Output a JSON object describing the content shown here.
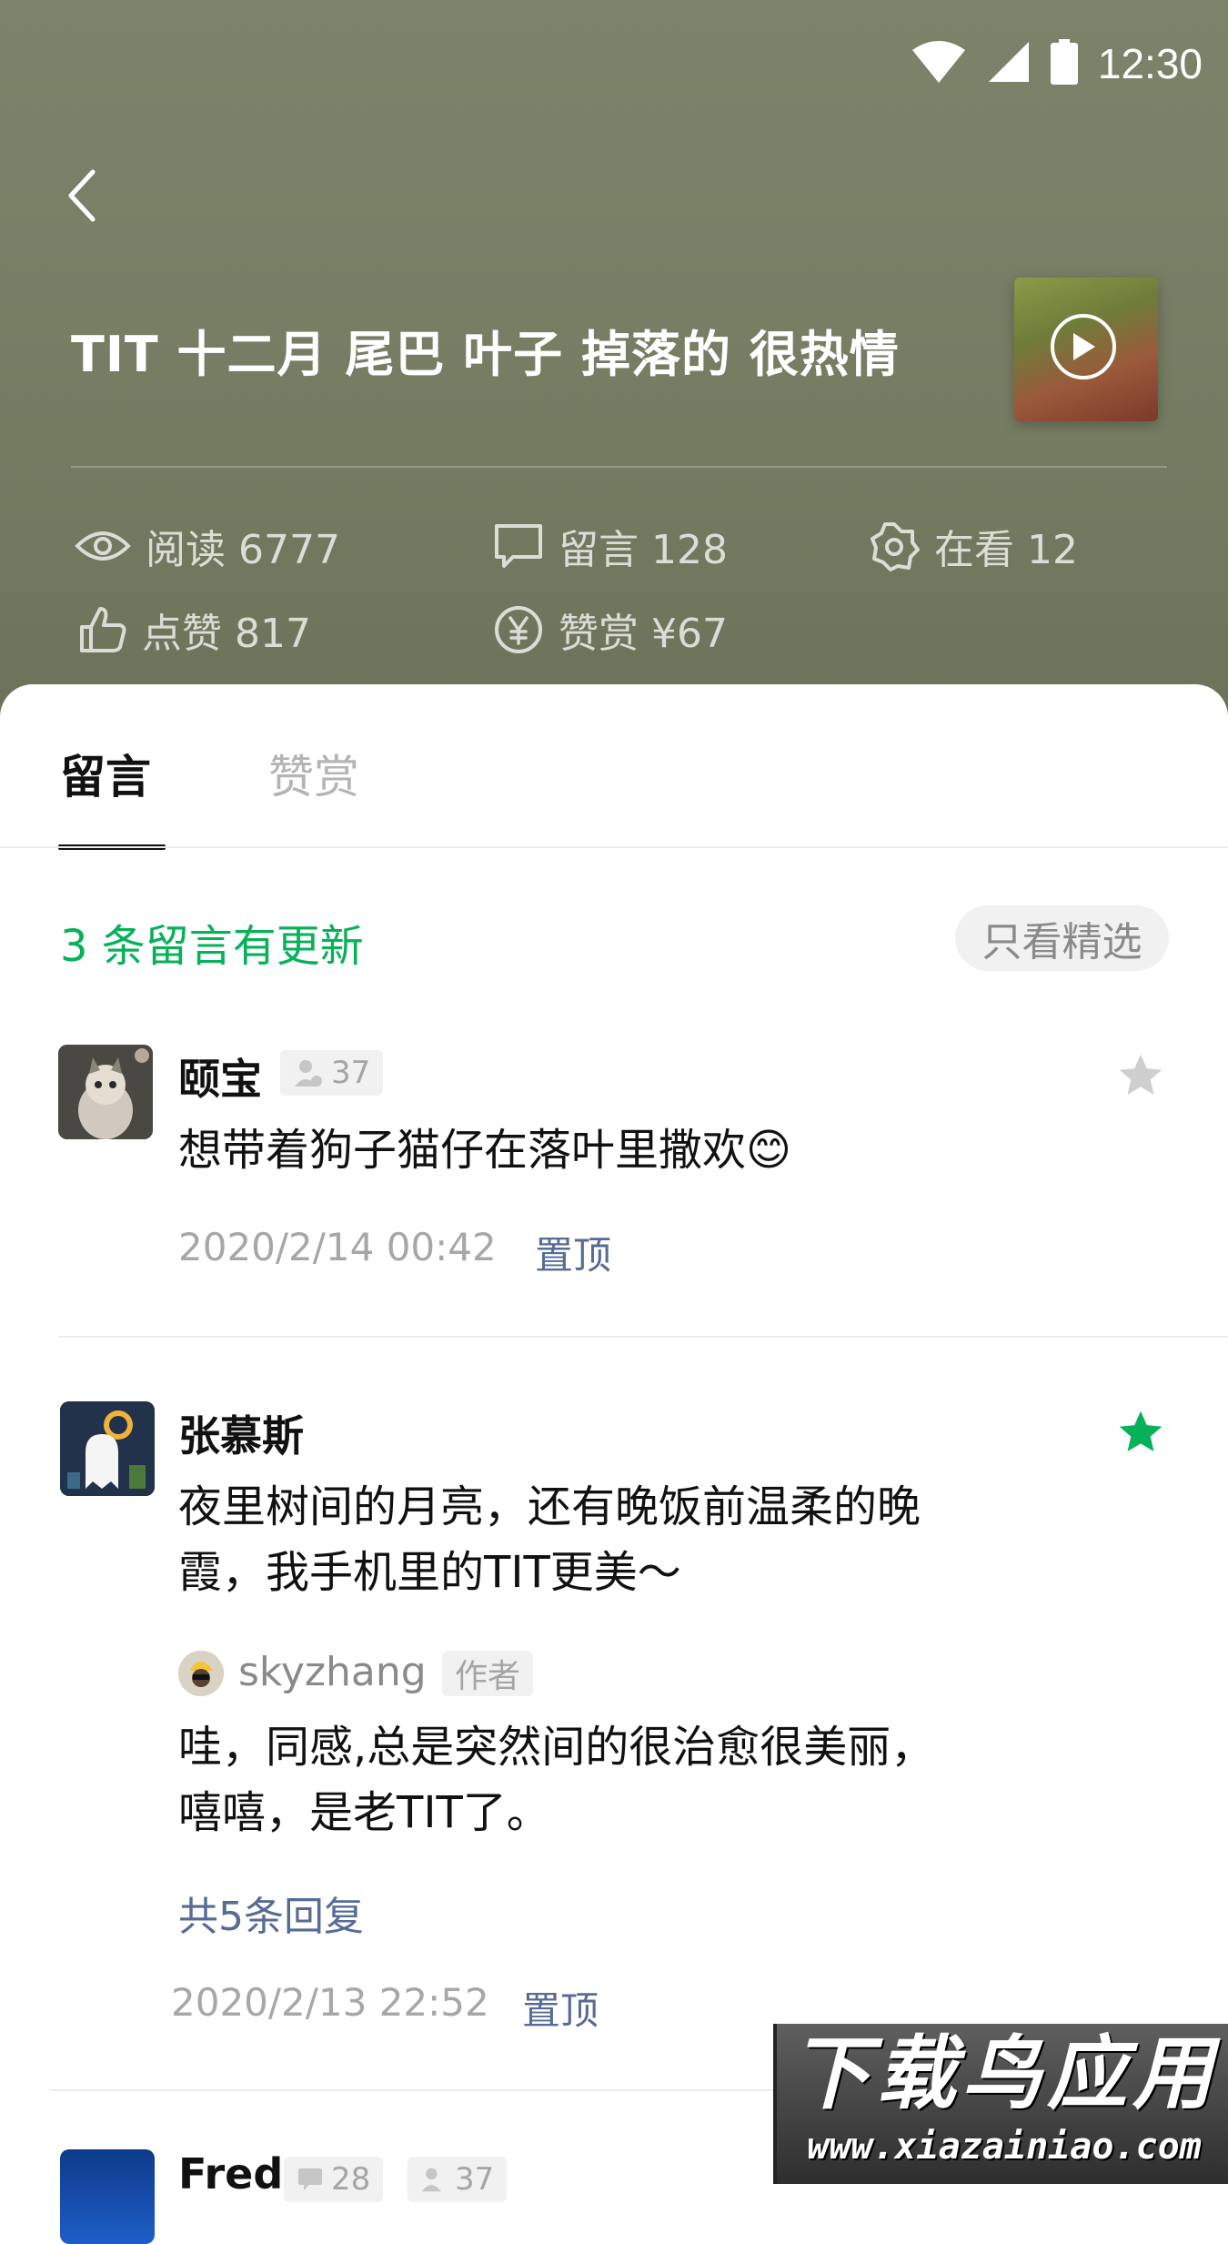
{
  "status_bar": {
    "time": "12:30",
    "icons": [
      "wifi-icon",
      "cellular-icon",
      "battery-icon"
    ]
  },
  "header": {
    "title": "TIT 十二月 尾巴 叶子 掉落的 很热情",
    "stats": {
      "reads": "阅读 6777",
      "comments": "留言 128",
      "watching": "在看 12",
      "likes": "点赞 817",
      "rewards": "赞赏 ¥67"
    }
  },
  "tabs": [
    {
      "label": "留言",
      "active": true
    },
    {
      "label": "赞赏",
      "active": false
    }
  ],
  "updates_notice": "3 条留言有更新",
  "filter_button": "只看精选",
  "comments": [
    {
      "author": "颐宝",
      "badge": "37",
      "text": "想带着狗子猫仔在落叶里撒欢😊",
      "time": "2020/2/14  00:42",
      "action": "置顶",
      "starred": false
    },
    {
      "author": "张慕斯",
      "text_lines": [
        "夜里树间的月亮，还有晚饭前温柔的晚",
        "霞，我手机里的TIT更美～"
      ],
      "reply": {
        "author": "skyzhang",
        "tag": "作者",
        "text_lines": [
          "哇，同感,总是突然间的很治愈很美丽，",
          "嘻嘻，是老TIT了。"
        ]
      },
      "more_replies": "共5条回复",
      "time": "2020/2/13  22:52",
      "action": "置顶",
      "starred": true
    },
    {
      "author": "Fred",
      "badges": [
        "28",
        "37"
      ]
    }
  ],
  "watermark": {
    "main": "下载鸟应用",
    "url": "www.xiazainiao.com"
  },
  "colors": {
    "header_bg": "#787e64",
    "accent_green": "#07b15a",
    "link_blue": "#576b95"
  }
}
